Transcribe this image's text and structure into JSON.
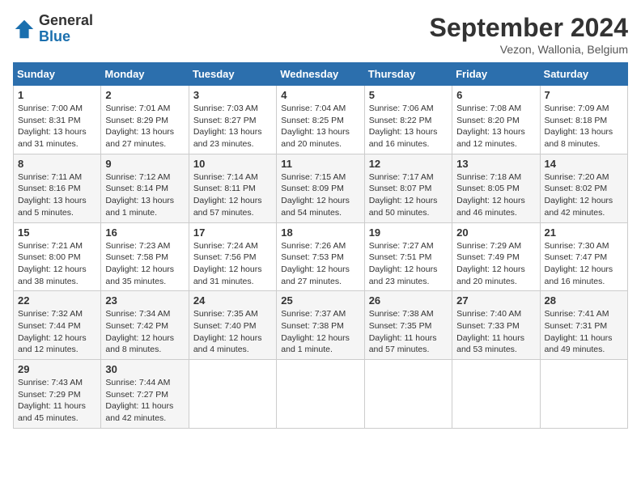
{
  "header": {
    "logo_general": "General",
    "logo_blue": "Blue",
    "month_title": "September 2024",
    "location": "Vezon, Wallonia, Belgium"
  },
  "weekdays": [
    "Sunday",
    "Monday",
    "Tuesday",
    "Wednesday",
    "Thursday",
    "Friday",
    "Saturday"
  ],
  "weeks": [
    [
      {
        "day": "1",
        "sunrise": "Sunrise: 7:00 AM",
        "sunset": "Sunset: 8:31 PM",
        "daylight": "Daylight: 13 hours and 31 minutes."
      },
      {
        "day": "2",
        "sunrise": "Sunrise: 7:01 AM",
        "sunset": "Sunset: 8:29 PM",
        "daylight": "Daylight: 13 hours and 27 minutes."
      },
      {
        "day": "3",
        "sunrise": "Sunrise: 7:03 AM",
        "sunset": "Sunset: 8:27 PM",
        "daylight": "Daylight: 13 hours and 23 minutes."
      },
      {
        "day": "4",
        "sunrise": "Sunrise: 7:04 AM",
        "sunset": "Sunset: 8:25 PM",
        "daylight": "Daylight: 13 hours and 20 minutes."
      },
      {
        "day": "5",
        "sunrise": "Sunrise: 7:06 AM",
        "sunset": "Sunset: 8:22 PM",
        "daylight": "Daylight: 13 hours and 16 minutes."
      },
      {
        "day": "6",
        "sunrise": "Sunrise: 7:08 AM",
        "sunset": "Sunset: 8:20 PM",
        "daylight": "Daylight: 13 hours and 12 minutes."
      },
      {
        "day": "7",
        "sunrise": "Sunrise: 7:09 AM",
        "sunset": "Sunset: 8:18 PM",
        "daylight": "Daylight: 13 hours and 8 minutes."
      }
    ],
    [
      {
        "day": "8",
        "sunrise": "Sunrise: 7:11 AM",
        "sunset": "Sunset: 8:16 PM",
        "daylight": "Daylight: 13 hours and 5 minutes."
      },
      {
        "day": "9",
        "sunrise": "Sunrise: 7:12 AM",
        "sunset": "Sunset: 8:14 PM",
        "daylight": "Daylight: 13 hours and 1 minute."
      },
      {
        "day": "10",
        "sunrise": "Sunrise: 7:14 AM",
        "sunset": "Sunset: 8:11 PM",
        "daylight": "Daylight: 12 hours and 57 minutes."
      },
      {
        "day": "11",
        "sunrise": "Sunrise: 7:15 AM",
        "sunset": "Sunset: 8:09 PM",
        "daylight": "Daylight: 12 hours and 54 minutes."
      },
      {
        "day": "12",
        "sunrise": "Sunrise: 7:17 AM",
        "sunset": "Sunset: 8:07 PM",
        "daylight": "Daylight: 12 hours and 50 minutes."
      },
      {
        "day": "13",
        "sunrise": "Sunrise: 7:18 AM",
        "sunset": "Sunset: 8:05 PM",
        "daylight": "Daylight: 12 hours and 46 minutes."
      },
      {
        "day": "14",
        "sunrise": "Sunrise: 7:20 AM",
        "sunset": "Sunset: 8:02 PM",
        "daylight": "Daylight: 12 hours and 42 minutes."
      }
    ],
    [
      {
        "day": "15",
        "sunrise": "Sunrise: 7:21 AM",
        "sunset": "Sunset: 8:00 PM",
        "daylight": "Daylight: 12 hours and 38 minutes."
      },
      {
        "day": "16",
        "sunrise": "Sunrise: 7:23 AM",
        "sunset": "Sunset: 7:58 PM",
        "daylight": "Daylight: 12 hours and 35 minutes."
      },
      {
        "day": "17",
        "sunrise": "Sunrise: 7:24 AM",
        "sunset": "Sunset: 7:56 PM",
        "daylight": "Daylight: 12 hours and 31 minutes."
      },
      {
        "day": "18",
        "sunrise": "Sunrise: 7:26 AM",
        "sunset": "Sunset: 7:53 PM",
        "daylight": "Daylight: 12 hours and 27 minutes."
      },
      {
        "day": "19",
        "sunrise": "Sunrise: 7:27 AM",
        "sunset": "Sunset: 7:51 PM",
        "daylight": "Daylight: 12 hours and 23 minutes."
      },
      {
        "day": "20",
        "sunrise": "Sunrise: 7:29 AM",
        "sunset": "Sunset: 7:49 PM",
        "daylight": "Daylight: 12 hours and 20 minutes."
      },
      {
        "day": "21",
        "sunrise": "Sunrise: 7:30 AM",
        "sunset": "Sunset: 7:47 PM",
        "daylight": "Daylight: 12 hours and 16 minutes."
      }
    ],
    [
      {
        "day": "22",
        "sunrise": "Sunrise: 7:32 AM",
        "sunset": "Sunset: 7:44 PM",
        "daylight": "Daylight: 12 hours and 12 minutes."
      },
      {
        "day": "23",
        "sunrise": "Sunrise: 7:34 AM",
        "sunset": "Sunset: 7:42 PM",
        "daylight": "Daylight: 12 hours and 8 minutes."
      },
      {
        "day": "24",
        "sunrise": "Sunrise: 7:35 AM",
        "sunset": "Sunset: 7:40 PM",
        "daylight": "Daylight: 12 hours and 4 minutes."
      },
      {
        "day": "25",
        "sunrise": "Sunrise: 7:37 AM",
        "sunset": "Sunset: 7:38 PM",
        "daylight": "Daylight: 12 hours and 1 minute."
      },
      {
        "day": "26",
        "sunrise": "Sunrise: 7:38 AM",
        "sunset": "Sunset: 7:35 PM",
        "daylight": "Daylight: 11 hours and 57 minutes."
      },
      {
        "day": "27",
        "sunrise": "Sunrise: 7:40 AM",
        "sunset": "Sunset: 7:33 PM",
        "daylight": "Daylight: 11 hours and 53 minutes."
      },
      {
        "day": "28",
        "sunrise": "Sunrise: 7:41 AM",
        "sunset": "Sunset: 7:31 PM",
        "daylight": "Daylight: 11 hours and 49 minutes."
      }
    ],
    [
      {
        "day": "29",
        "sunrise": "Sunrise: 7:43 AM",
        "sunset": "Sunset: 7:29 PM",
        "daylight": "Daylight: 11 hours and 45 minutes."
      },
      {
        "day": "30",
        "sunrise": "Sunrise: 7:44 AM",
        "sunset": "Sunset: 7:27 PM",
        "daylight": "Daylight: 11 hours and 42 minutes."
      },
      null,
      null,
      null,
      null,
      null
    ]
  ]
}
